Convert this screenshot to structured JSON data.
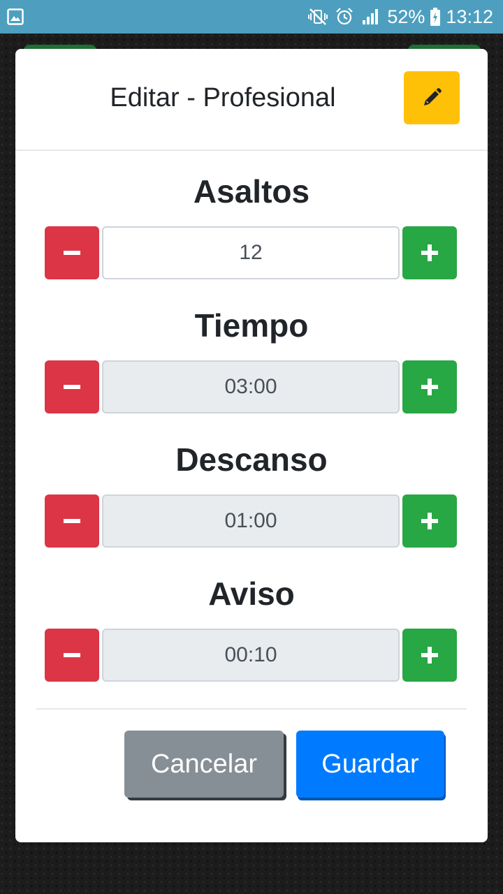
{
  "status_bar": {
    "battery": "52%",
    "time": "13:12",
    "icons": [
      "gallery-icon",
      "vibrate-off-icon",
      "alarm-icon",
      "signal-icon",
      "battery-charging-icon"
    ]
  },
  "modal": {
    "title": "Editar - Profesional",
    "edit_icon": "pencil-icon",
    "edit_color": "#ffc107"
  },
  "fields": [
    {
      "label": "Asaltos",
      "value": "12",
      "editable": true
    },
    {
      "label": "Tiempo",
      "value": "03:00",
      "editable": false
    },
    {
      "label": "Descanso",
      "value": "01:00",
      "editable": false
    },
    {
      "label": "Aviso",
      "value": "00:10",
      "editable": false
    }
  ],
  "buttons": {
    "cancel": "Cancelar",
    "save": "Guardar"
  },
  "colors": {
    "status_bar": "#4e9fbf",
    "minus": "#dc3545",
    "plus": "#28a745",
    "cancel": "#868e96",
    "save": "#007bff"
  }
}
